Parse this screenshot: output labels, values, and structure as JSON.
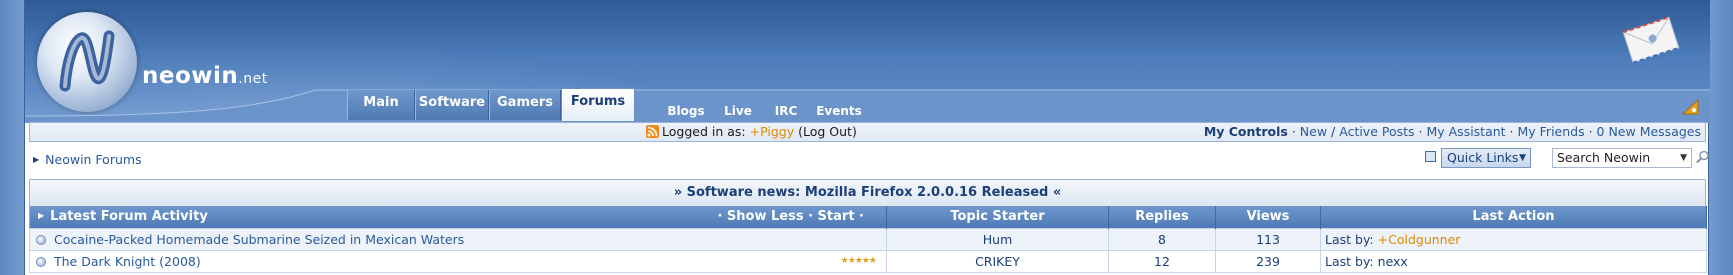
{
  "header": {
    "logo_name": "neowin",
    "logo_tld": ".net",
    "main_tabs": [
      "Main",
      "Software",
      "Gamers",
      "Forums"
    ],
    "active_tab": "Forums",
    "sub_tabs": [
      "Blogs",
      "Live",
      "IRC",
      "Events"
    ]
  },
  "userbar": {
    "logged_in_label": "Logged in as:",
    "username": "+Piggy",
    "logout_open": "(",
    "logout_label": "Log Out",
    "logout_close": ")",
    "my_controls": "My Controls",
    "new_label": "New",
    "active_posts": "Active Posts",
    "my_assistant": "My Assistant",
    "my_friends": "My Friends",
    "new_messages": "0 New Messages"
  },
  "nav": {
    "breadcrumb": "Neowin Forums",
    "quick_links": "Quick Links",
    "search_placeholder": "Search Neowin"
  },
  "news": {
    "text": "» Software news: Mozilla Firefox 2.0.0.16 Released «"
  },
  "table": {
    "title": "Latest Forum Activity",
    "controls": "· Show Less · Start ·",
    "columns": [
      "Topic Starter",
      "Replies",
      "Views",
      "Last Action"
    ],
    "rows": [
      {
        "topic": "Cocaine-Packed Homemade Submarine Seized in Mexican Waters",
        "starter": "Hum",
        "replies": "8",
        "views": "113",
        "last_prefix": "Last by:",
        "last_user": "+Coldgunner",
        "rating": 0
      },
      {
        "topic": "The Dark Knight (2008)",
        "starter": "CRIKEY",
        "replies": "12",
        "views": "239",
        "last_prefix": "Last by:",
        "last_user": "nexx",
        "rating": 5
      }
    ]
  },
  "colors": {
    "header_blue": "#4c7bb9",
    "link_blue": "#2a5a9c",
    "username_orange": "#e08a00"
  },
  "icons": [
    "globe-logo-icon",
    "envelope-icon",
    "rss-icon",
    "quick-links-icon",
    "search-icon",
    "star-icon",
    "bullet-icon"
  ]
}
